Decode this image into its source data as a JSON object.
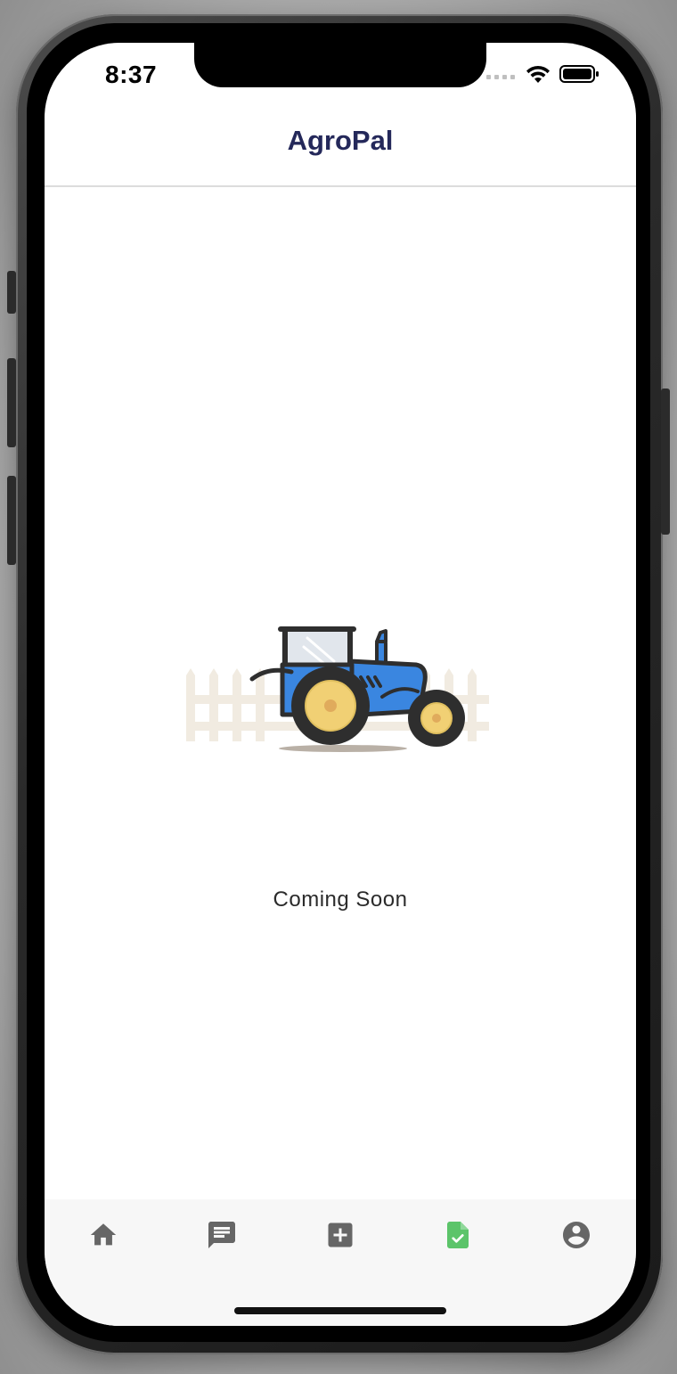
{
  "status_bar": {
    "time": "8:37",
    "signal_icon": "cellular-signal-icon",
    "wifi_icon": "wifi-icon",
    "battery_icon": "battery-icon"
  },
  "header": {
    "title": "AgroPal"
  },
  "main": {
    "illustration_icon": "tractor-illustration",
    "message": "Coming Soon"
  },
  "bottom_nav": {
    "active_index": 3,
    "active_color": "#5cc46a",
    "inactive_color": "#666666",
    "items": [
      {
        "icon": "home-icon"
      },
      {
        "icon": "message-icon"
      },
      {
        "icon": "add-box-icon"
      },
      {
        "icon": "document-check-icon"
      },
      {
        "icon": "account-circle-icon"
      }
    ]
  },
  "colors": {
    "title": "#24285a",
    "tractor_body": "#3a86e0",
    "wheel_hub": "#f1d074",
    "fence": "#f1ebe1"
  }
}
